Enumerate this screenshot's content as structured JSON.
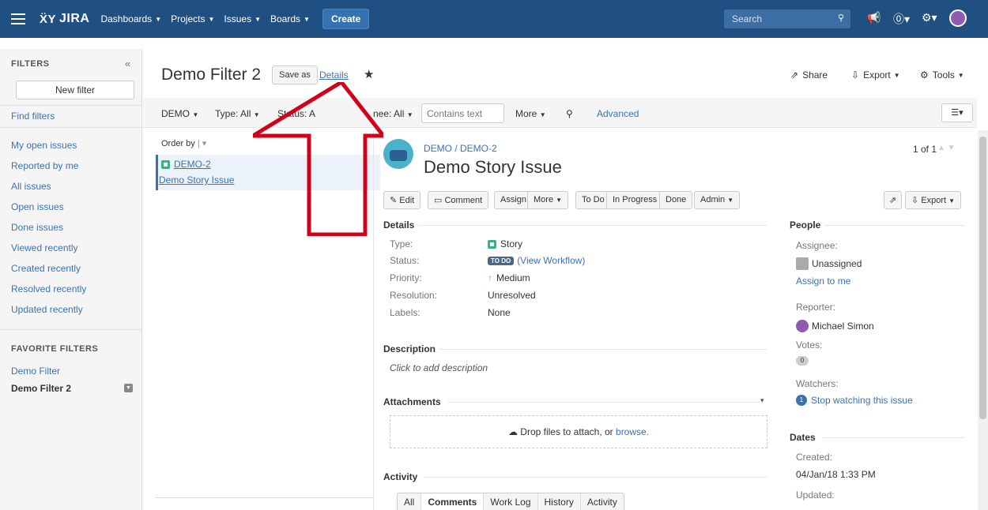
{
  "topnav": {
    "logo": "JIRA",
    "items": [
      {
        "label": "Dashboards"
      },
      {
        "label": "Projects"
      },
      {
        "label": "Issues"
      },
      {
        "label": "Boards"
      }
    ],
    "create_label": "Create",
    "search_placeholder": "Search"
  },
  "sidebar": {
    "filters_heading": "FILTERS",
    "new_filter_label": "New filter",
    "find_filters_label": "Find filters",
    "links": [
      "My open issues",
      "Reported by me",
      "All issues",
      "Open issues",
      "Done issues",
      "Viewed recently",
      "Created recently",
      "Resolved recently",
      "Updated recently"
    ],
    "favorite_heading": "FAVORITE FILTERS",
    "favorites": [
      "Demo Filter",
      "Demo Filter 2"
    ]
  },
  "header": {
    "title": "Demo Filter 2",
    "save_as_label": "Save as",
    "details_label": "Details",
    "share_label": "Share",
    "export_label": "Export",
    "tools_label": "Tools"
  },
  "filterbar": {
    "project": "DEMO",
    "type": "Type: All",
    "status": "Status: A",
    "assignee": "nee: All",
    "contains_placeholder": "Contains text",
    "more": "More",
    "advanced": "Advanced"
  },
  "issue_list": {
    "order_by": "Order by",
    "items": [
      {
        "key": "DEMO-2",
        "summary": "Demo Story Issue"
      }
    ]
  },
  "issue": {
    "breadcrumb": "DEMO / DEMO-2",
    "title": "Demo Story Issue",
    "pager": "1 of 1",
    "toolbar": {
      "edit": "Edit",
      "comment": "Comment",
      "assign": "Assign",
      "more": "More",
      "todo": "To Do",
      "in_progress": "In Progress",
      "done": "Done",
      "admin": "Admin",
      "export": "Export"
    },
    "details": {
      "heading": "Details",
      "type_label": "Type:",
      "type_value": "Story",
      "status_label": "Status:",
      "status_badge": "TO DO",
      "status_workflow": "(View Workflow)",
      "priority_label": "Priority:",
      "priority_value": "Medium",
      "resolution_label": "Resolution:",
      "resolution_value": "Unresolved",
      "labels_label": "Labels:",
      "labels_value": "None"
    },
    "description": {
      "heading": "Description",
      "placeholder": "Click to add description"
    },
    "attachments": {
      "heading": "Attachments",
      "drop_text": "Drop files to attach, or",
      "browse": "browse."
    },
    "activity": {
      "heading": "Activity",
      "tabs": [
        "All",
        "Comments",
        "Work Log",
        "History",
        "Activity"
      ],
      "active_tab": "Comments"
    },
    "people": {
      "heading": "People",
      "assignee_label": "Assignee:",
      "assignee_value": "Unassigned",
      "assign_to_me": "Assign to me",
      "reporter_label": "Reporter:",
      "reporter_value": "Michael Simon",
      "votes_label": "Votes:",
      "votes_value": "0",
      "watchers_label": "Watchers:",
      "watchers_count": "1",
      "watchers_link": "Stop watching this issue"
    },
    "dates": {
      "heading": "Dates",
      "created_label": "Created:",
      "created_value": "04/Jan/18 1:33 PM",
      "updated_label": "Updated:"
    }
  },
  "colors": {
    "nav_bg": "#205081",
    "link": "#3b73af",
    "annotation_arrow": "#d0021b"
  }
}
